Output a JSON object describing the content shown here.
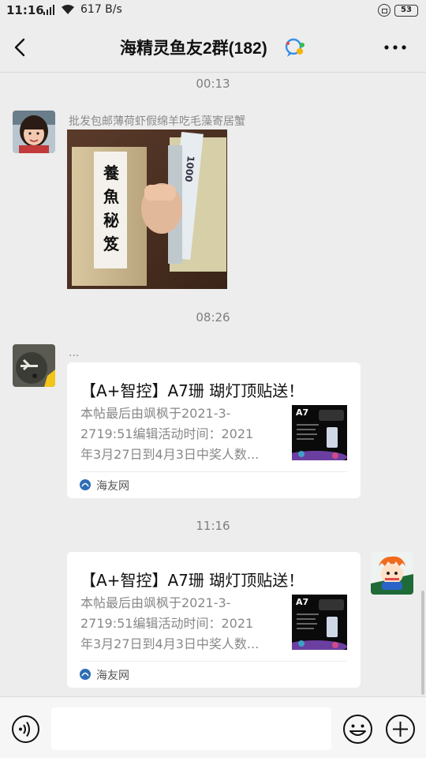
{
  "status_bar": {
    "time": "11:16",
    "signal": "4G",
    "net_speed": "617 B/s",
    "battery": "53"
  },
  "chat": {
    "title": "海精灵鱼友2群(182)"
  },
  "messages": [
    {
      "type": "timestamp",
      "text": "00:13"
    },
    {
      "type": "image",
      "sender_name": "批发包邮薄荷虾假绵羊吃毛藻寄居蟹",
      "image_text": [
        "養",
        "魚",
        "秘",
        "笈"
      ],
      "banknote_text": "1000"
    },
    {
      "type": "timestamp",
      "text": "08:26"
    },
    {
      "type": "link_card",
      "sender_name": "...",
      "title": "【A+智控】A7珊 瑚灯顶贴送！",
      "desc_lines": [
        "本帖最后由飒枫于2021-3-",
        "2719:51编辑活动时间：2021",
        "年3月27日到4月3日中奖人数..."
      ],
      "thumb_label": "A7",
      "source": "海友网"
    },
    {
      "type": "timestamp",
      "text": "11:16"
    },
    {
      "type": "link_card",
      "self": true,
      "title": "【A+智控】A7珊 瑚灯顶贴送！",
      "desc_lines": [
        "本帖最后由飒枫于2021-3-",
        "2719:51编辑活动时间：2021",
        "年3月27日到4月3日中奖人数..."
      ],
      "thumb_label": "A7",
      "source": "海友网"
    }
  ],
  "colors": {
    "background": "#ededed",
    "card": "#ffffff",
    "timestamp": "#7e7e7e",
    "source_icon": "#2f6db5"
  },
  "icons": [
    "back-arrow",
    "group-chat",
    "more-dots",
    "voice",
    "emoji",
    "plus"
  ]
}
